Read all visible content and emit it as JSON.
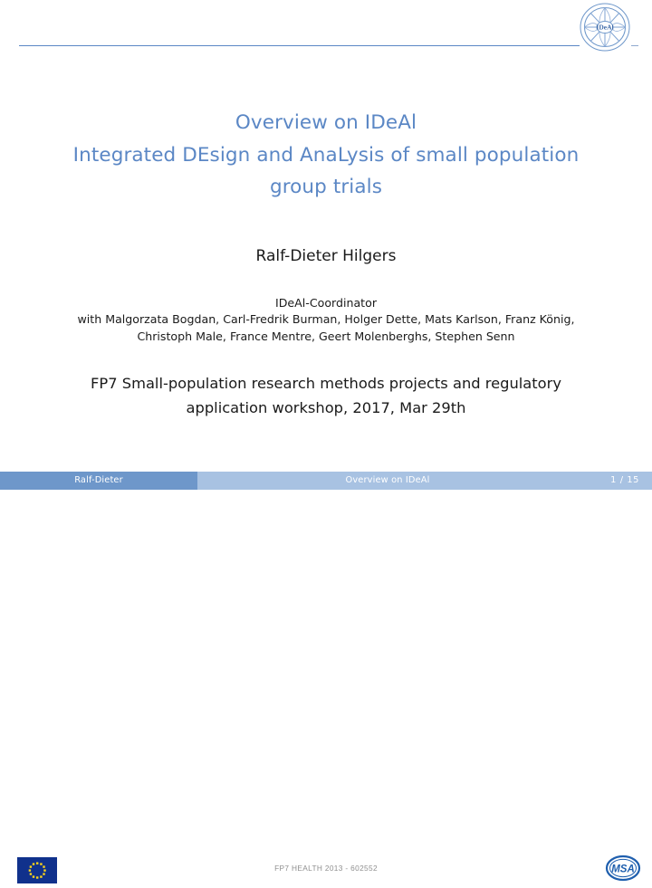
{
  "header": {
    "logo_text": "IDeAl",
    "logo_name": "ideal-wheel-logo"
  },
  "title": {
    "line1": "Overview on IDeAl",
    "line2": "Integrated DEsign and AnaLysis of small population",
    "line3": "group trials",
    "color": "#5b87c5"
  },
  "author": {
    "name": "Ralf-Dieter Hilgers"
  },
  "affiliation": {
    "role": "IDeAl-Coordinator",
    "coauthors_line1": "with Malgorzata Bogdan, Carl-Fredrik Burman, Holger Dette, Mats Karlson, Franz König,",
    "coauthors_line2": "Christoph Male, France Mentre, Geert Molenberghs, Stephen Senn"
  },
  "event": {
    "line1": "FP7 Small-population research methods projects and regulatory",
    "line2": "application workshop, 2017, Mar 29th"
  },
  "funding": {
    "grant_text": "FP7 HEALTH 2013 - 602552",
    "eu_flag_name": "eu-flag",
    "msa_text": "MSA"
  },
  "footer": {
    "author": "Ralf-Dieter",
    "title": "Overview on IDeAl",
    "page": "1 / 15",
    "bar_color_dark": "#6e97ca",
    "bar_color_light": "#a8c2e2"
  }
}
